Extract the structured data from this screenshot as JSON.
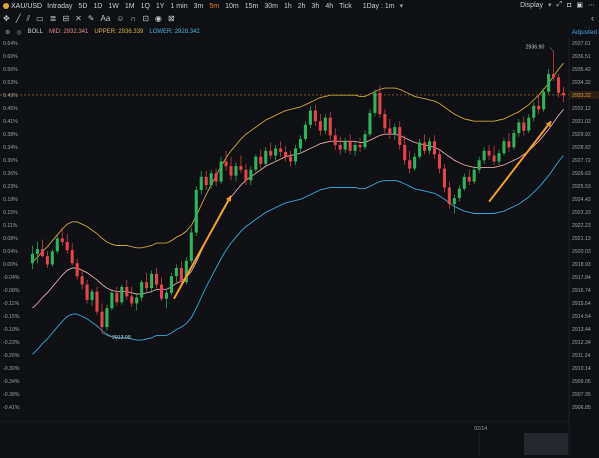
{
  "toolbar": {
    "symbol": "XAU/USD",
    "timeframes": [
      "Intraday",
      "5D",
      "1D",
      "1W",
      "1M",
      "1Q",
      "1Y",
      "1 min",
      "3m",
      "5m",
      "10m",
      "15m",
      "30m",
      "1h",
      "2h",
      "3h",
      "4h",
      "Tick"
    ],
    "active_timeframe": "5m",
    "range": "1Day : 1m",
    "display": "Display"
  },
  "indicator": {
    "name": "BOLL",
    "mid_label": "MID: 2932.341",
    "upper_label": "UPPER: 2936.339",
    "lower_label": "LOWER: 2928.342"
  },
  "adjusted_label": "Adjusted",
  "chart_data": {
    "type": "candlestick",
    "pct_ticks": [
      "0.64%",
      "0.60%",
      "0.56%",
      "0.53%",
      "0.49%",
      "0.45%",
      "0.41%",
      "0.38%",
      "0.34%",
      "0.30%",
      "0.26%",
      "0.23%",
      "0.19%",
      "0.15%",
      "0.11%",
      "0.08%",
      "0.04%",
      "0.00%",
      "-0.04%",
      "-0.08%",
      "-0.11%",
      "-0.15%",
      "-0.19%",
      "-0.23%",
      "-0.26%",
      "-0.30%",
      "-0.34%",
      "-0.38%",
      "-0.41%"
    ],
    "price_ticks": [
      "2937.61",
      "2936.51",
      "2935.42",
      "2934.32",
      "2933.22",
      "2932.12",
      "2931.02",
      "2929.92",
      "2928.82",
      "2927.72",
      "2926.63",
      "2925.53",
      "2924.43",
      "2923.33",
      "2922.23",
      "2921.13",
      "2920.03",
      "2918.93",
      "2917.84",
      "2916.74",
      "2915.64",
      "2914.54",
      "2913.44",
      "2912.34",
      "2911.24",
      "2910.14",
      "2909.05",
      "2907.95",
      "2906.85"
    ],
    "ylim": [
      2906.85,
      2937.61
    ],
    "current_price": 2933.22,
    "high_annotation": "2936.90",
    "low_annotation": "2913.08",
    "x_label": "02/14",
    "colors": {
      "up": "#2cb65b",
      "down": "#e8434b",
      "mid": "#e2a8a4",
      "upper": "#cda53e",
      "lower": "#3aa7d6",
      "arrow": "#f0a028",
      "current": "#c77d2e"
    },
    "candles": [
      [
        2919.0,
        2920.5,
        2918.5,
        2919.8
      ],
      [
        2919.8,
        2920.8,
        2919.0,
        2920.2
      ],
      [
        2920.2,
        2921.0,
        2919.5,
        2919.6
      ],
      [
        2919.6,
        2920.0,
        2918.6,
        2918.9
      ],
      [
        2918.9,
        2920.2,
        2918.7,
        2920.0
      ],
      [
        2920.0,
        2921.4,
        2919.8,
        2921.1
      ],
      [
        2921.1,
        2922.0,
        2920.5,
        2920.8
      ],
      [
        2920.8,
        2921.5,
        2919.8,
        2920.1
      ],
      [
        2920.1,
        2920.7,
        2918.8,
        2919.0
      ],
      [
        2919.0,
        2919.4,
        2917.6,
        2917.9
      ],
      [
        2917.9,
        2918.5,
        2916.8,
        2917.2
      ],
      [
        2917.2,
        2917.6,
        2915.6,
        2915.9
      ],
      [
        2915.9,
        2916.8,
        2915.4,
        2916.6
      ],
      [
        2916.6,
        2917.0,
        2914.6,
        2914.9
      ],
      [
        2914.9,
        2915.6,
        2913.1,
        2913.6
      ],
      [
        2913.6,
        2915.5,
        2913.3,
        2915.2
      ],
      [
        2915.2,
        2916.8,
        2915.0,
        2916.5
      ],
      [
        2916.5,
        2917.0,
        2915.4,
        2915.7
      ],
      [
        2915.7,
        2917.2,
        2915.5,
        2917.0
      ],
      [
        2917.0,
        2917.6,
        2915.9,
        2916.2
      ],
      [
        2916.2,
        2917.0,
        2915.3,
        2915.6
      ],
      [
        2915.6,
        2916.4,
        2915.0,
        2916.1
      ],
      [
        2916.1,
        2917.6,
        2915.8,
        2917.4
      ],
      [
        2917.4,
        2918.2,
        2916.6,
        2916.9
      ],
      [
        2916.9,
        2918.4,
        2916.5,
        2918.1
      ],
      [
        2918.1,
        2918.6,
        2916.9,
        2917.2
      ],
      [
        2917.2,
        2917.8,
        2915.8,
        2916.0
      ],
      [
        2916.0,
        2916.8,
        2915.2,
        2916.5
      ],
      [
        2916.5,
        2918.2,
        2916.3,
        2917.9
      ],
      [
        2917.9,
        2918.9,
        2917.4,
        2918.6
      ],
      [
        2918.6,
        2919.2,
        2917.0,
        2917.4
      ],
      [
        2917.4,
        2919.5,
        2917.2,
        2919.2
      ],
      [
        2919.2,
        2922.0,
        2919.0,
        2921.6
      ],
      [
        2921.6,
        2925.5,
        2921.3,
        2925.2
      ],
      [
        2925.2,
        2926.8,
        2924.8,
        2926.3
      ],
      [
        2926.3,
        2926.8,
        2925.2,
        2925.6
      ],
      [
        2925.6,
        2926.9,
        2925.3,
        2926.6
      ],
      [
        2926.6,
        2927.0,
        2925.5,
        2925.9
      ],
      [
        2925.9,
        2928.0,
        2925.7,
        2927.6
      ],
      [
        2927.6,
        2928.5,
        2926.8,
        2927.2
      ],
      [
        2927.2,
        2928.0,
        2926.0,
        2926.4
      ],
      [
        2926.4,
        2927.5,
        2925.9,
        2927.2
      ],
      [
        2927.2,
        2928.1,
        2926.6,
        2926.9
      ],
      [
        2926.9,
        2927.4,
        2925.6,
        2926.0
      ],
      [
        2926.0,
        2927.2,
        2925.6,
        2926.9
      ],
      [
        2926.9,
        2928.2,
        2926.7,
        2928.0
      ],
      [
        2928.0,
        2928.6,
        2927.0,
        2927.4
      ],
      [
        2927.4,
        2928.8,
        2927.2,
        2928.5
      ],
      [
        2928.5,
        2929.2,
        2927.8,
        2928.1
      ],
      [
        2928.1,
        2929.0,
        2927.6,
        2928.7
      ],
      [
        2928.7,
        2929.3,
        2928.0,
        2928.4
      ],
      [
        2928.4,
        2928.9,
        2927.6,
        2928.0
      ],
      [
        2928.0,
        2928.5,
        2927.2,
        2927.6
      ],
      [
        2927.6,
        2929.0,
        2927.3,
        2928.7
      ],
      [
        2928.7,
        2929.8,
        2928.4,
        2929.5
      ],
      [
        2929.5,
        2931.0,
        2929.3,
        2930.7
      ],
      [
        2930.7,
        2932.3,
        2930.4,
        2931.9
      ],
      [
        2931.9,
        2932.4,
        2930.6,
        2931.0
      ],
      [
        2931.0,
        2931.6,
        2929.8,
        2930.2
      ],
      [
        2930.2,
        2931.6,
        2929.9,
        2931.3
      ],
      [
        2931.3,
        2931.8,
        2929.4,
        2929.8
      ],
      [
        2929.8,
        2930.4,
        2928.6,
        2929.0
      ],
      [
        2929.0,
        2929.7,
        2928.2,
        2928.6
      ],
      [
        2928.6,
        2929.6,
        2928.3,
        2929.3
      ],
      [
        2929.3,
        2929.9,
        2928.2,
        2928.5
      ],
      [
        2928.5,
        2929.3,
        2928.1,
        2929.0
      ],
      [
        2929.0,
        2929.6,
        2928.4,
        2928.8
      ],
      [
        2928.8,
        2930.2,
        2928.6,
        2929.9
      ],
      [
        2929.9,
        2932.0,
        2929.7,
        2931.7
      ],
      [
        2931.7,
        2933.7,
        2931.4,
        2933.4
      ],
      [
        2933.4,
        2934.0,
        2931.3,
        2931.6
      ],
      [
        2931.6,
        2932.0,
        2930.0,
        2930.4
      ],
      [
        2930.4,
        2931.2,
        2929.5,
        2929.9
      ],
      [
        2929.9,
        2930.8,
        2929.4,
        2930.5
      ],
      [
        2930.5,
        2931.0,
        2928.6,
        2929.0
      ],
      [
        2929.0,
        2929.8,
        2927.3,
        2927.7
      ],
      [
        2927.7,
        2928.5,
        2926.6,
        2927.0
      ],
      [
        2927.0,
        2928.3,
        2926.8,
        2928.0
      ],
      [
        2928.0,
        2929.5,
        2927.8,
        2929.2
      ],
      [
        2929.2,
        2929.9,
        2928.2,
        2928.5
      ],
      [
        2928.5,
        2929.6,
        2928.2,
        2929.3
      ],
      [
        2929.3,
        2929.8,
        2927.8,
        2928.2
      ],
      [
        2928.2,
        2928.6,
        2926.6,
        2927.0
      ],
      [
        2927.0,
        2927.4,
        2925.0,
        2925.4
      ],
      [
        2925.4,
        2925.9,
        2923.6,
        2924.0
      ],
      [
        2924.0,
        2924.8,
        2923.2,
        2924.5
      ],
      [
        2924.5,
        2925.6,
        2924.2,
        2925.3
      ],
      [
        2925.3,
        2926.6,
        2925.1,
        2926.3
      ],
      [
        2926.3,
        2926.9,
        2925.6,
        2925.9
      ],
      [
        2925.9,
        2927.2,
        2925.7,
        2926.9
      ],
      [
        2926.9,
        2928.0,
        2926.6,
        2927.7
      ],
      [
        2927.7,
        2928.8,
        2927.4,
        2928.5
      ],
      [
        2928.5,
        2929.0,
        2927.7,
        2928.1
      ],
      [
        2928.1,
        2928.9,
        2927.3,
        2927.6
      ],
      [
        2927.6,
        2928.6,
        2927.3,
        2928.3
      ],
      [
        2928.3,
        2929.6,
        2928.1,
        2929.3
      ],
      [
        2929.3,
        2930.0,
        2928.4,
        2928.8
      ],
      [
        2928.8,
        2930.3,
        2928.6,
        2930.0
      ],
      [
        2930.0,
        2931.2,
        2929.7,
        2930.9
      ],
      [
        2930.9,
        2931.4,
        2929.8,
        2930.2
      ],
      [
        2930.2,
        2931.6,
        2930.0,
        2931.3
      ],
      [
        2931.3,
        2932.6,
        2931.0,
        2932.3
      ],
      [
        2932.3,
        2933.2,
        2931.6,
        2932.0
      ],
      [
        2932.0,
        2933.8,
        2931.8,
        2933.5
      ],
      [
        2933.5,
        2935.4,
        2933.3,
        2935.0
      ],
      [
        2935.0,
        2936.9,
        2934.4,
        2934.7
      ],
      [
        2934.7,
        2935.0,
        2933.0,
        2933.4
      ],
      [
        2933.4,
        2933.9,
        2932.6,
        2933.2
      ]
    ],
    "mid": [
      2915.2,
      2915.6,
      2916.1,
      2916.5,
      2917.0,
      2917.5,
      2918.0,
      2918.4,
      2918.6,
      2918.6,
      2918.4,
      2918.2,
      2917.9,
      2917.6,
      2917.2,
      2916.9,
      2916.7,
      2916.6,
      2916.6,
      2916.6,
      2916.5,
      2916.4,
      2916.4,
      2916.5,
      2916.6,
      2916.8,
      2916.8,
      2916.8,
      2917.0,
      2917.3,
      2917.5,
      2917.8,
      2918.3,
      2919.1,
      2920.0,
      2920.9,
      2921.7,
      2922.5,
      2923.3,
      2924.0,
      2924.6,
      2925.1,
      2925.6,
      2926.0,
      2926.3,
      2926.6,
      2926.9,
      2927.2,
      2927.4,
      2927.6,
      2927.8,
      2928.0,
      2928.1,
      2928.2,
      2928.3,
      2928.5,
      2928.7,
      2928.9,
      2929.1,
      2929.2,
      2929.3,
      2929.3,
      2929.3,
      2929.3,
      2929.3,
      2929.3,
      2929.2,
      2929.2,
      2929.4,
      2929.6,
      2929.8,
      2929.9,
      2929.9,
      2929.9,
      2929.8,
      2929.6,
      2929.4,
      2929.2,
      2929.1,
      2929.0,
      2928.9,
      2928.8,
      2928.6,
      2928.3,
      2928.0,
      2927.7,
      2927.5,
      2927.3,
      2927.2,
      2927.1,
      2927.1,
      2927.1,
      2927.1,
      2927.1,
      2927.2,
      2927.3,
      2927.5,
      2927.7,
      2927.9,
      2928.2,
      2928.5,
      2928.9,
      2929.3,
      2929.8,
      2930.3,
      2930.9,
      2931.5,
      2932.0
    ]
  }
}
